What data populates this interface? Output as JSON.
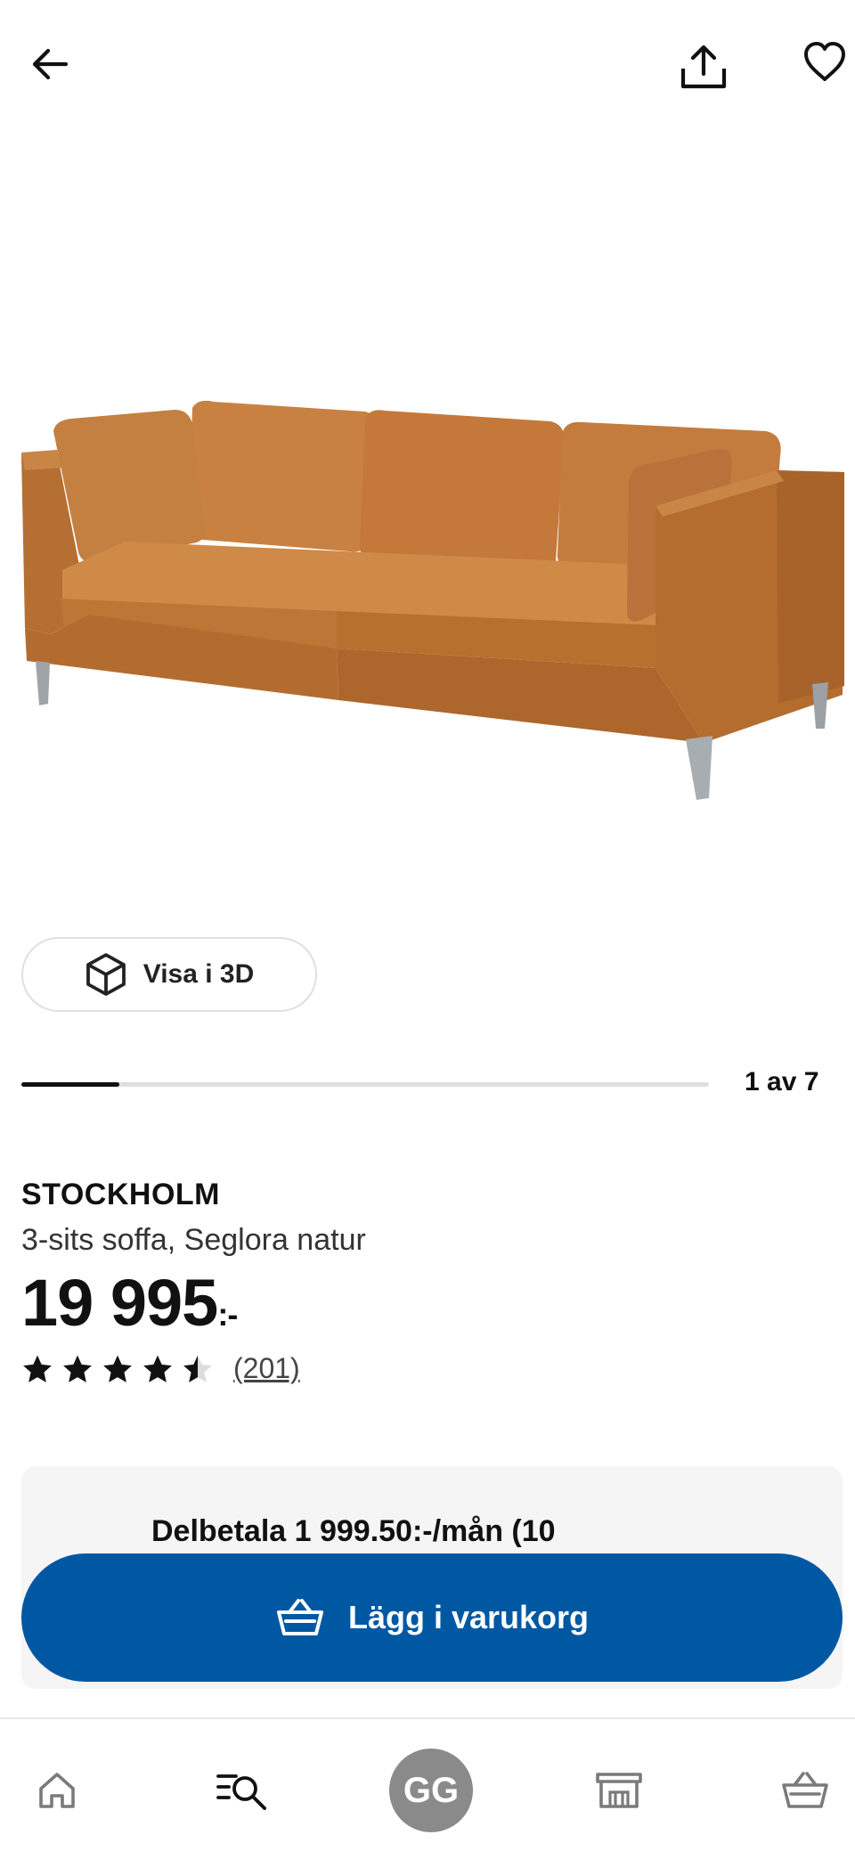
{
  "header": {
    "back_icon": "arrow-left-icon",
    "share_icon": "share-icon",
    "favorite_icon": "heart-outline-icon"
  },
  "gallery": {
    "image_alt": "STOCKHOLM 3-sits soffa, Seglora natur",
    "view_3d_label": "Visa i 3D",
    "view_3d_icon": "cube-icon",
    "counter": "1 av 7",
    "current": 1,
    "total": 7
  },
  "product": {
    "name": "STOCKHOLM",
    "description": "3-sits soffa, Seglora natur",
    "price": "19 995",
    "price_suffix": ":-",
    "rating": 4.5,
    "rating_max": 5,
    "reviews": "(201)"
  },
  "financing": {
    "text": "Delbetala 1 999.50:-/mån (10"
  },
  "cta": {
    "label": "Lägg i varukorg",
    "icon": "basket-icon",
    "color": "#0058a3"
  },
  "bottom_nav": {
    "items": [
      {
        "icon": "home-icon"
      },
      {
        "icon": "search-list-icon"
      },
      {
        "icon": "avatar",
        "initials": "GG"
      },
      {
        "icon": "store-icon"
      },
      {
        "icon": "basket-icon"
      }
    ]
  },
  "colors": {
    "brand_blue": "#0058a3",
    "avatar_gray": "#8a8a8a",
    "sofa_leather": "#c07a3e"
  }
}
